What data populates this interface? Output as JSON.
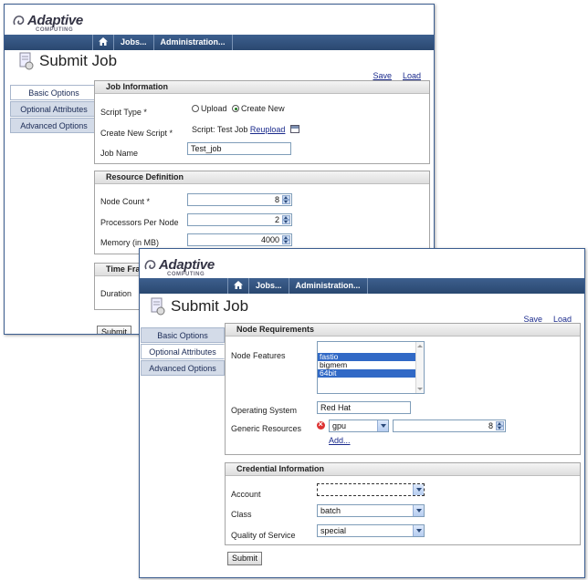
{
  "brand": {
    "name": "Adaptive",
    "sub": "COMPUTING"
  },
  "nav": {
    "home_icon": "home-icon",
    "jobs": "Jobs...",
    "admin": "Administration..."
  },
  "page": {
    "title": "Submit Job",
    "save": "Save",
    "load": "Load"
  },
  "sidebar": {
    "items": [
      "Basic Options",
      "Optional Attributes",
      "Advanced Options"
    ]
  },
  "win1": {
    "job_info": {
      "heading": "Job Information",
      "script_type_label": "Script Type *",
      "upload": "Upload",
      "create_new": "Create New",
      "create_script_label": "Create New Script *",
      "script_value": "Script: Test Job",
      "reupload": "Reupload",
      "job_name_label": "Job Name",
      "job_name_value": "Test_job"
    },
    "resources": {
      "heading": "Resource Definition",
      "node_count_label": "Node Count *",
      "node_count": "8",
      "ppn_label": "Processors Per Node",
      "ppn": "2",
      "memory_label": "Memory (in MB)",
      "memory": "4000"
    },
    "time": {
      "heading": "Time Fra",
      "duration_label": "Duration"
    },
    "submit": "Submit"
  },
  "win2": {
    "node_req": {
      "heading": "Node Requirements",
      "features_label": "Node Features",
      "features": [
        {
          "label": "fastio",
          "selected": true
        },
        {
          "label": "bigmem",
          "selected": false
        },
        {
          "label": "64bit",
          "selected": true
        }
      ],
      "os_label": "Operating System",
      "os_value": "Red Hat",
      "gres_label": "Generic Resources",
      "gres_value": "gpu",
      "gres_count": "8",
      "add": "Add..."
    },
    "cred": {
      "heading": "Credential Information",
      "account_label": "Account",
      "account_value": "",
      "class_label": "Class",
      "class_value": "batch",
      "qos_label": "Quality of Service",
      "qos_value": "special"
    },
    "submit": "Submit"
  },
  "colors": {
    "navbar": "#2f5080",
    "sidebar": "#d3dbe8",
    "selection": "#3169c6"
  }
}
